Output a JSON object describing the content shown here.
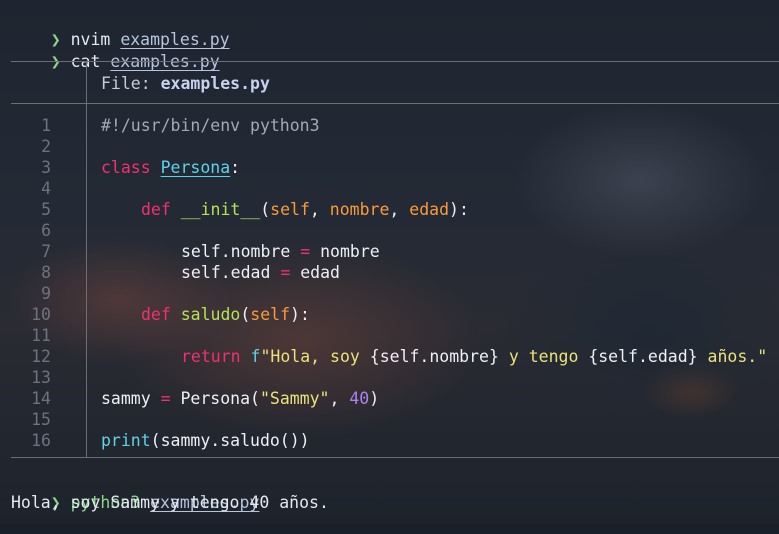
{
  "terminal": {
    "prompt_symbol": "❯",
    "commands": [
      {
        "cmd": "nvim",
        "file": "examples.py"
      },
      {
        "cmd": "cat",
        "file": "examples.py"
      }
    ],
    "run_command": {
      "cmd": "python3",
      "file": "examples.py"
    },
    "output": "Hola, soy Sammy y tengo 40 años."
  },
  "viewer": {
    "header_label": "File: ",
    "header_file": "examples.py",
    "line_numbers": [
      "1",
      "2",
      "3",
      "4",
      "5",
      "6",
      "7",
      "8",
      "9",
      "10",
      "11",
      "12",
      "13",
      "14",
      "15",
      "16"
    ]
  },
  "code": {
    "l1": "#!/usr/bin/env python3",
    "l3_kw": "class",
    "l3_name": "Persona",
    "l3_colon": ":",
    "l5_kw": "def",
    "l5_fn": "__init__",
    "l5_open": "(",
    "l5_p1": "self",
    "l5_c1": ", ",
    "l5_p2": "nombre",
    "l5_c2": ", ",
    "l5_p3": "edad",
    "l5_close": "):",
    "l7_a": "self.nombre ",
    "l7_op": "=",
    "l7_b": " nombre",
    "l8_a": "self.edad ",
    "l8_op": "=",
    "l8_b": " edad",
    "l10_kw": "def",
    "l10_fn": "saludo",
    "l10_open": "(",
    "l10_p1": "self",
    "l10_close": "):",
    "l12_kw": "return",
    "l12_f": "f",
    "l12_s1": "\"Hola, soy ",
    "l12_e1": "{self.nombre}",
    "l12_s2": " y tengo ",
    "l12_e2": "{self.edad}",
    "l12_s3": " años.\"",
    "l14_a": "sammy ",
    "l14_op": "=",
    "l14_b": " Persona(",
    "l14_str": "\"Sammy\"",
    "l14_c": ", ",
    "l14_num": "40",
    "l14_close": ")",
    "l16_fn": "print",
    "l16_rest": "(sammy.saludo())"
  },
  "colors": {
    "keyword": "#f0306f",
    "class_name": "#5ed2e8",
    "function": "#b4e354",
    "parameter": "#fb9a3a",
    "string": "#ece27a",
    "number": "#ac82f0",
    "prompt": "#8bd58a"
  }
}
